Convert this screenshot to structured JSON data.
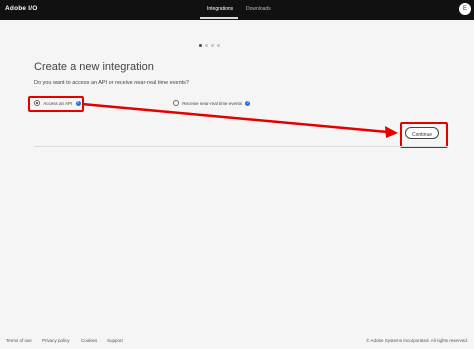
{
  "header": {
    "brand": "Adobe I/O",
    "tabs": [
      {
        "label": "Integrations",
        "active": true
      },
      {
        "label": "Downloads",
        "active": false
      }
    ],
    "avatar_initial": "E"
  },
  "wizard": {
    "steps_total": 4,
    "current_step": 1
  },
  "main": {
    "title": "Create a new integration",
    "question": "Do you want to access an API or receive near-real time events?",
    "options": [
      {
        "label": "Access an API",
        "selected": true,
        "info_icon": "info-icon"
      },
      {
        "label": "Receive near-real time events",
        "selected": false,
        "info_icon": "info-icon"
      }
    ],
    "continue_label": "Continue"
  },
  "annotation": {
    "color": "#e50000"
  },
  "footer": {
    "links": [
      "Terms of use",
      "Privacy policy",
      "Cookies",
      "Support"
    ],
    "copyright": "© Adobe Systems Incorporated. All rights reserved."
  },
  "colors": {
    "topbar": "#111111",
    "background": "#f5f5f5",
    "accent": "#1473e6"
  }
}
